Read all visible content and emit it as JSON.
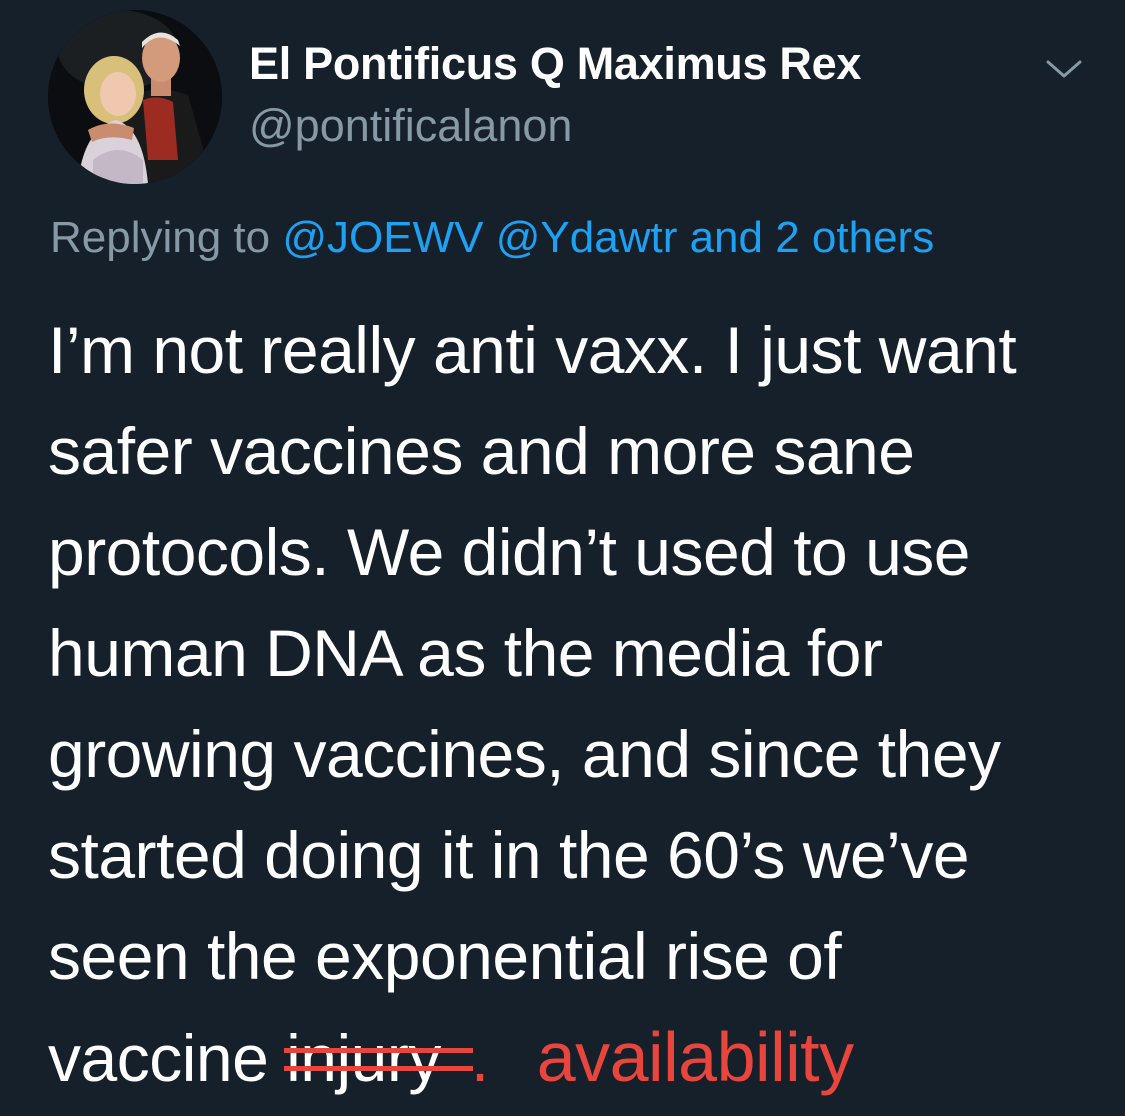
{
  "author": {
    "display_name": "El Pontificus Q Maximus Rex",
    "handle": "@pontificalanon"
  },
  "reply": {
    "prefix": "Replying to",
    "mentions": [
      "@JOEWV",
      "@Ydawtr"
    ],
    "others": "and 2 others"
  },
  "tweet_lines": [
    "I’m not really anti vaxx. I just want",
    "safer vaccines and more sane",
    "protocols.  We didn’t used to use",
    "human DNA as the media for",
    "growing vaccines, and since they",
    "started doing it in the 60’s we’ve",
    "seen the exponential rise of"
  ],
  "last_line": {
    "lead": "vaccine ",
    "struck_word": "injury",
    "struck_dot": ".",
    "annotation": "availability"
  },
  "colors": {
    "background": "#15202b",
    "handle_gray": "#8899a6",
    "link_blue": "#1da1f2",
    "annotation_red": "#e8453c"
  },
  "icons": {
    "menu": "chevron-down-icon"
  }
}
